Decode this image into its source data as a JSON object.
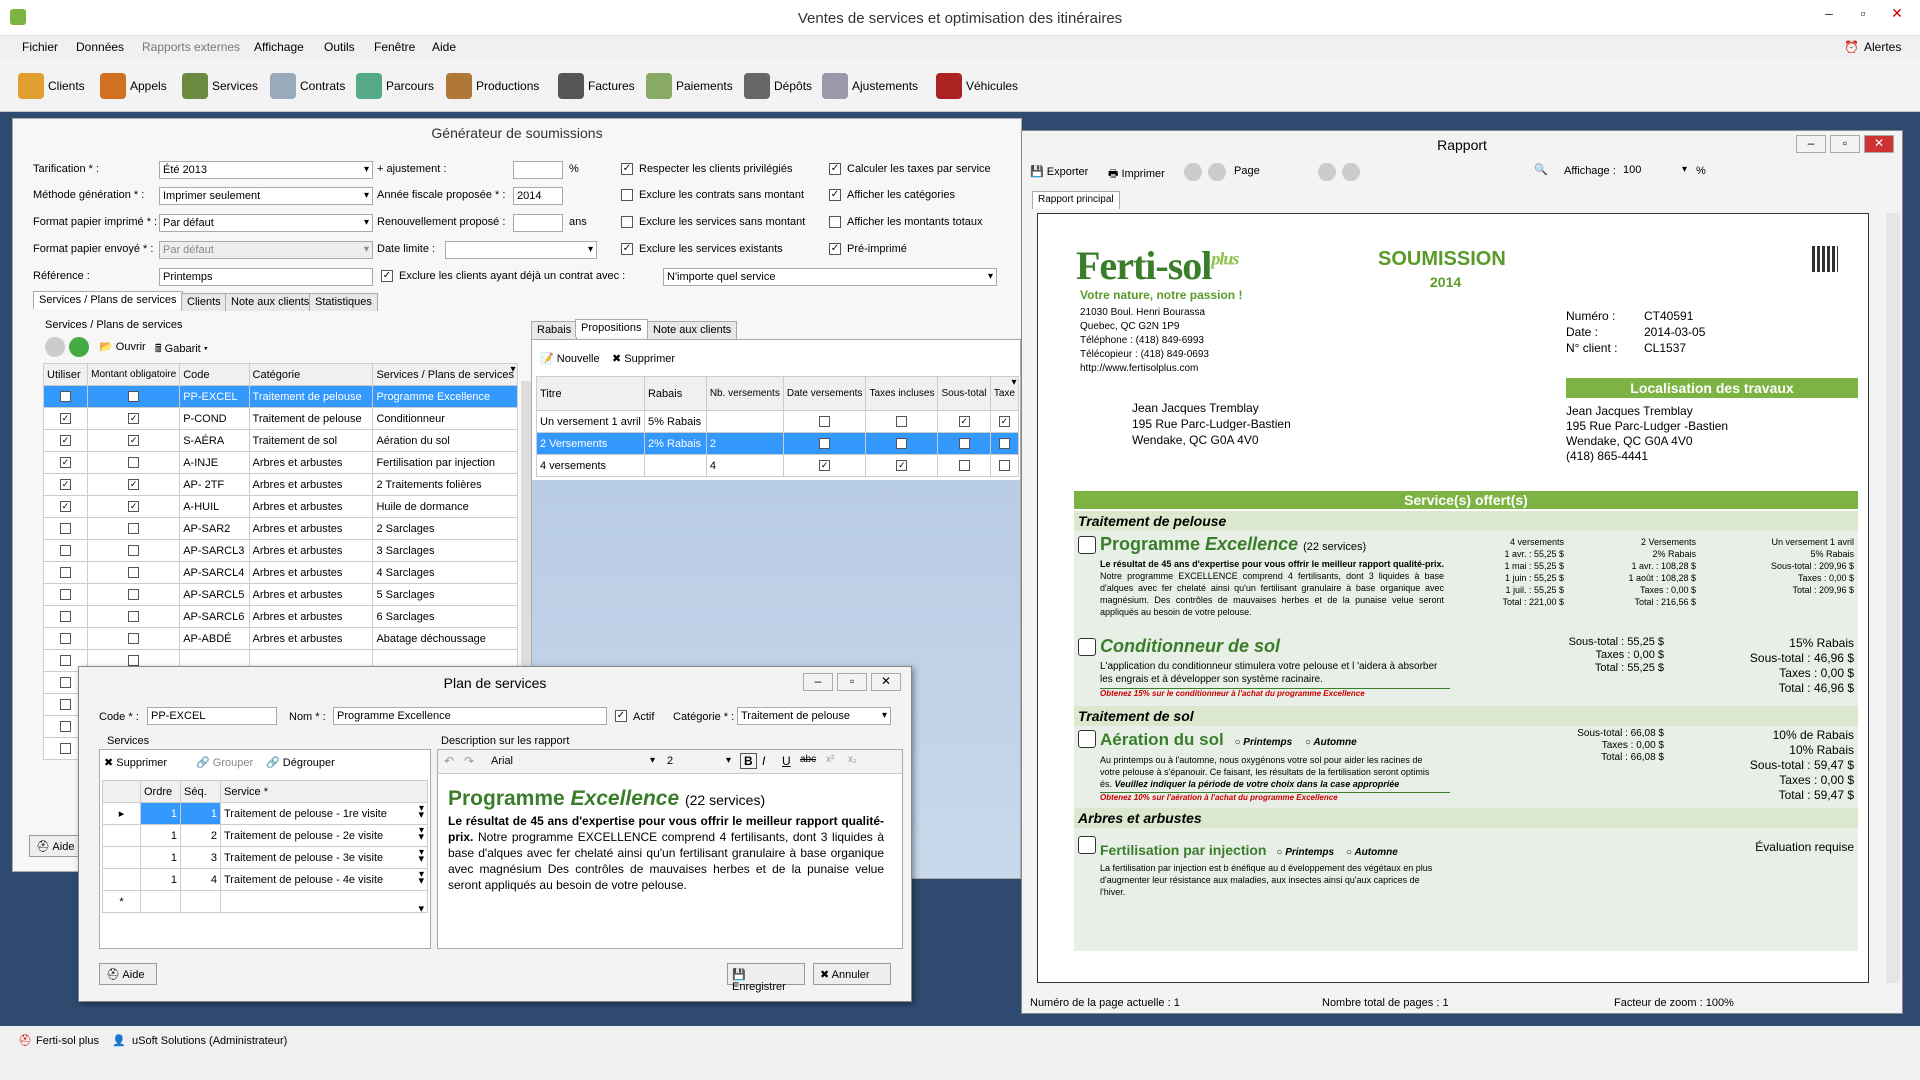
{
  "app": {
    "title": "Ventes de services et optimisation des itinéraires",
    "alerts": "Alertes"
  },
  "menu": [
    "Fichier",
    "Données",
    "Rapports externes",
    "Affichage",
    "Outils",
    "Fenêtre",
    "Aide"
  ],
  "toolbar": [
    "Clients",
    "Appels",
    "Services",
    "Contrats",
    "Parcours",
    "Productions",
    "Factures",
    "Paiements",
    "Dépôts",
    "Ajustements",
    "Véhicules"
  ],
  "gen": {
    "title": "Générateur de soumissions",
    "labels": {
      "tarification": "Tarification * :",
      "methode": "Méthode génération * :",
      "format_imp": "Format papier imprimé * :",
      "format_env": "Format papier envoyé * :",
      "reference": "Référence :",
      "ajustement": "+ ajustement :",
      "pct": "%",
      "annee": "Année fiscale proposée * :",
      "renouv": "Renouvellement proposé :",
      "ans": "ans",
      "date_limite": "Date limite :"
    },
    "values": {
      "tarification": "Été 2013",
      "methode": "Imprimer seulement",
      "format_imp": "Par défaut",
      "format_env": "Par défaut",
      "reference": "Printemps",
      "annee": "2014",
      "exclure_sel": "N'importe quel service"
    },
    "checks": [
      {
        "label": "Respecter les clients privilégiés",
        "on": true
      },
      {
        "label": "Exclure les contrats sans montant",
        "on": false
      },
      {
        "label": "Exclure les services sans montant",
        "on": false
      },
      {
        "label": "Exclure les services existants",
        "on": true
      },
      {
        "label": "Calculer les taxes par service",
        "on": true
      },
      {
        "label": "Afficher les catégories",
        "on": true
      },
      {
        "label": "Afficher les montants totaux",
        "on": false
      },
      {
        "label": "Pré-imprimé",
        "on": true
      }
    ],
    "exclure_label": "Exclure les clients ayant déjà un contrat avec :",
    "tabs": [
      "Services / Plans de services",
      "Clients",
      "Note aux clients",
      "Statistiques"
    ],
    "group_label": "Services / Plans de services",
    "subtool": {
      "ouvrir": "Ouvrir",
      "gabarit": "Gabarit"
    },
    "svc_headers": [
      "Utiliser",
      "Montant obligatoire",
      "Code",
      "Catégorie",
      "Services / Plans de services"
    ],
    "svc_rows": [
      {
        "u": true,
        "m": true,
        "code": "PP-EXCEL",
        "cat": "Traitement de pelouse",
        "svc": "Programme Excellence"
      },
      {
        "u": true,
        "m": true,
        "code": "P-COND",
        "cat": "Traitement de pelouse",
        "svc": "Conditionneur"
      },
      {
        "u": true,
        "m": true,
        "code": "S-AÉRA",
        "cat": "Traitement de sol",
        "svc": "Aération du sol"
      },
      {
        "u": true,
        "m": false,
        "code": "A-INJE",
        "cat": "Arbres et arbustes",
        "svc": "Fertilisation par injection"
      },
      {
        "u": true,
        "m": true,
        "code": "AP- 2TF",
        "cat": "Arbres et arbustes",
        "svc": "2 Traitements folières"
      },
      {
        "u": true,
        "m": true,
        "code": "A-HUIL",
        "cat": "Arbres et arbustes",
        "svc": "Huile de dormance"
      },
      {
        "u": false,
        "m": false,
        "code": "AP-SAR2",
        "cat": "Arbres et arbustes",
        "svc": "2 Sarclages"
      },
      {
        "u": false,
        "m": false,
        "code": "AP-SARCL3",
        "cat": "Arbres et arbustes",
        "svc": "3 Sarclages"
      },
      {
        "u": false,
        "m": false,
        "code": "AP-SARCL4",
        "cat": "Arbres et arbustes",
        "svc": "4 Sarclages"
      },
      {
        "u": false,
        "m": false,
        "code": "AP-SARCL5",
        "cat": "Arbres et arbustes",
        "svc": "5 Sarclages"
      },
      {
        "u": false,
        "m": false,
        "code": "AP-SARCL6",
        "cat": "Arbres et arbustes",
        "svc": "6 Sarclages"
      },
      {
        "u": false,
        "m": false,
        "code": "AP-ABDÉ",
        "cat": "Arbres et arbustes",
        "svc": "Abatage déchoussage"
      }
    ],
    "rtabs": [
      "Rabais",
      "Propositions",
      "Note aux clients"
    ],
    "rtool": {
      "nouvelle": "Nouvelle",
      "supprimer": "Supprimer"
    },
    "prop_headers": [
      "Titre",
      "Rabais",
      "Nb. versements",
      "Date versements",
      "Taxes incluses",
      "Sous-total",
      "Taxe"
    ],
    "prop_rows": [
      {
        "titre": "Un versement 1 avril",
        "rabais": "5% Rabais",
        "nb": "",
        "d": false,
        "t": false,
        "s": true,
        "x": true
      },
      {
        "titre": "2 Versements",
        "rabais": "2% Rabais",
        "nb": "2",
        "d": true,
        "t": true,
        "s": false,
        "x": false
      },
      {
        "titre": "4 versements",
        "rabais": "",
        "nb": "4",
        "d": true,
        "t": true,
        "s": false,
        "x": false
      }
    ],
    "aide": "Aide"
  },
  "plan": {
    "title": "Plan de services",
    "code_l": "Code * :",
    "code": "PP-EXCEL",
    "nom_l": "Nom * :",
    "nom": "Programme Excellence",
    "actif": "Actif",
    "cat_l": "Catégorie * :",
    "cat": "Traitement de pelouse",
    "services_l": "Services",
    "desc_l": "Description sur les rapport",
    "tool": [
      "Supprimer",
      "Grouper",
      "Dégrouper"
    ],
    "font": "Arial",
    "size": "2",
    "headers": [
      "Ordre",
      "Séq.",
      "Service *"
    ],
    "rows": [
      {
        "o": "1",
        "s": "1",
        "svc": "Traitement de pelouse - 1re visite"
      },
      {
        "o": "1",
        "s": "2",
        "svc": "Traitement de pelouse - 2e visite"
      },
      {
        "o": "1",
        "s": "3",
        "svc": "Traitement de pelouse - 3e visite"
      },
      {
        "o": "1",
        "s": "4",
        "svc": "Traitement de pelouse - 4e visite"
      }
    ],
    "desc_title1": "Programme ",
    "desc_title2": "Excellence",
    "desc_count": "(22 services)",
    "desc_bold": "Le résultat de 45 ans d'expertise pour vous offrir le meilleur rapport qualité-prix.",
    "desc_text": "Notre programme EXCELLENCE comprend 4 fertilisants, dont 3 liquides à base d'alques avec fer chelaté ainsi qu'un fertilisant granulaire à base organique avec magnésium Des contrôles de mauvaises herbes et de la punaise velue seront appliqués au besoin de votre pelouse.",
    "aide": "Aide",
    "save": "Enregistrer",
    "cancel": "Annuler"
  },
  "rapport": {
    "title": "Rapport",
    "tool": {
      "exporter": "Exporter",
      "imprimer": "Imprimer",
      "page": "Page",
      "affichage": "Affichage :",
      "zoom": "100",
      "pct": "%"
    },
    "tab": "Rapport principal",
    "logo": "Ferti-sol",
    "logo_plus": "plus",
    "slogan": "Votre nature, notre passion !",
    "company": [
      "21030 Boul. Henri Bourassa",
      "Quebec, QC  G2N 1P9",
      "Téléphone : (418) 849-6993",
      "Télécopieur : (418) 849-0693",
      "http://www.fertisolplus.com"
    ],
    "doc_title": "SOUMISSION",
    "doc_year": "2014",
    "meta": [
      {
        "k": "Numéro :",
        "v": "CT40591"
      },
      {
        "k": "Date :",
        "v": "2014-03-05"
      },
      {
        "k": "N° client :",
        "v": "CL1537"
      }
    ],
    "client": [
      "Jean Jacques Tremblay",
      "195 Rue Parc-Ludger-Bastien",
      "Wendake, QC  G0A 4V0"
    ],
    "loc_title": "Localisation des travaux",
    "loc": [
      "Jean Jacques Tremblay",
      "195 Rue Parc-Ludger -Bastien",
      "Wendake, QC  G0A 4V0",
      "(418) 865-4441"
    ],
    "offered": "Service(s) offert(s)",
    "cat1": "Traitement de pelouse",
    "s1_t1": "Programme ",
    "s1_t2": "Excellence",
    "s1_count": "(22 services)",
    "s1_bold": "Le résultat de 45 ans d'expertise pour vous offrir le meilleur rapport qualité-prix.",
    "s1_text": "Notre programme EXCELLENCE comprend 4 fertilisants, dont 3 liquides à base d'alques avec fer chelaté ainsi qu'un fertilisant granulaire à base organique avec magnésium. Des contrôles de mauvaises herbes et de la punaise velue seront appliqués au besoin de votre pelouse.",
    "col_a": [
      "4 versements",
      "1 avr. : 55,25 $",
      "1 mai : 55,25 $",
      "1 juin : 55,25 $",
      "1 juil. : 55,25 $",
      "Total : 221,00 $"
    ],
    "col_b": [
      "2 Versements",
      "2% Rabais",
      "1 avr. : 108,28 $",
      "1 août : 108,28 $",
      "Taxes : 0,00 $",
      "Total : 216,56 $"
    ],
    "col_c": [
      "Un versement 1 avril",
      "5% Rabais",
      "Sous-total : 209,96 $",
      "Taxes : 0,00 $",
      "Total : 209,96 $"
    ],
    "s2_title": "Conditionneur de sol",
    "s2_text": "L'application du conditionneur stimulera votre pelouse et l 'aidera à absorber les engrais et à développer son système racinaire.",
    "s2_note": "Obtenez 15% sur le conditionneur à l'achat du programme Excellence",
    "s2_mid": [
      "Sous-total : 55,25 $",
      "Taxes : 0,00 $",
      "Total : 55,25 $"
    ],
    "s2_right": [
      "15% Rabais",
      "Sous-total : 46,96 $",
      "Taxes : 0,00 $",
      "Total : 46,96 $"
    ],
    "cat2": "Traitement de sol",
    "s3_title": "Aération du sol",
    "opt1": "Printemps",
    "opt2": "Automne",
    "s3_text": "Au printemps ou à l'automne, nous oxygénons votre sol pour aider les racines de votre pelouse à s'épanouir. Ce faisant, les résultats de la fertilisation seront optimis és.",
    "s3_bold": "Veuillez indiquer la période de votre choix dans la case appropriée",
    "s3_note": "Obtenez 10% sur l'aération à l'achat du programme Excellence",
    "s3_mid": [
      "Sous-total : 66,08 $",
      "Taxes : 0,00 $",
      "Total : 66,08 $"
    ],
    "s3_right": [
      "10% de Rabais",
      "10% Rabais",
      "Sous-total : 59,47 $",
      "Taxes : 0,00 $",
      "Total : 59,47 $"
    ],
    "cat3": "Arbres et arbustes",
    "s4_title": "Fertilisation par injection",
    "s4_eval": "Évaluation requise",
    "s4_text": "La fertilisation par injection est b énéfique au d éveloppement des végétaux en plus d'augmenter leur résistance aux maladies, aux insectes ainsi qu'aux caprices de l'hiver.",
    "status": {
      "page": "Numéro de la page actuelle : 1",
      "total": "Nombre total de pages : 1",
      "zoom": "Facteur de zoom : 100%"
    }
  },
  "status": {
    "app": "Ferti-sol plus",
    "user": "uSoft Solutions (Administrateur)"
  }
}
